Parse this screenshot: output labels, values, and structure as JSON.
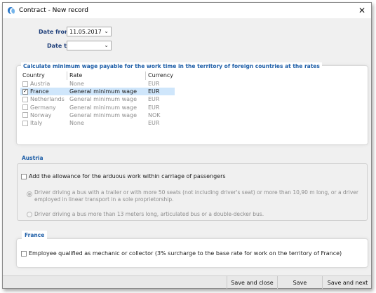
{
  "window": {
    "title": "Contract - New record"
  },
  "form": {
    "date_from": {
      "label": "Date from",
      "value": "11.05.2017"
    },
    "date_to": {
      "label": "Date to",
      "value": ""
    }
  },
  "rates_group": {
    "title": "Calculate minimum wage payable for the work time in the territory of foreign countries at the rates",
    "columns": [
      "Country",
      "Rate",
      "Currency"
    ],
    "rows": [
      {
        "country": "Austria",
        "rate": "None",
        "currency": "EUR",
        "checked": false
      },
      {
        "country": "France",
        "rate": "General minimum wage",
        "currency": "EUR",
        "checked": true
      },
      {
        "country": "Netherlands",
        "rate": "General minimum wage",
        "currency": "EUR",
        "checked": false
      },
      {
        "country": "Germany",
        "rate": "General minimum wage",
        "currency": "EUR",
        "checked": false
      },
      {
        "country": "Norway",
        "rate": "General minimum wage",
        "currency": "NOK",
        "checked": false
      },
      {
        "country": "Italy",
        "rate": "None",
        "currency": "EUR",
        "checked": false
      }
    ]
  },
  "austria": {
    "title": "Austria",
    "allowance_label": "Add the allowance for the arduous work within carriage of passengers",
    "option1": "Driver driving a bus with a trailer or with more 50 seats (not including driver's seat) or more than 10,90 m long, or a driver employed in linear transport in a sole proprietorship.",
    "option2": "Driver driving a bus more than 13 meters long, articulated bus or a double-decker bus."
  },
  "france": {
    "title": "France",
    "mechanic_label": "Employee qualified as mechanic or collector (3% surcharge to the base rate for work on the territory of France)"
  },
  "footer": {
    "save_close": "Save and close",
    "save": "Save",
    "save_next": "Save and next"
  },
  "colors": {
    "accent": "#1f5fa8",
    "selection": "#cfe6fb"
  }
}
